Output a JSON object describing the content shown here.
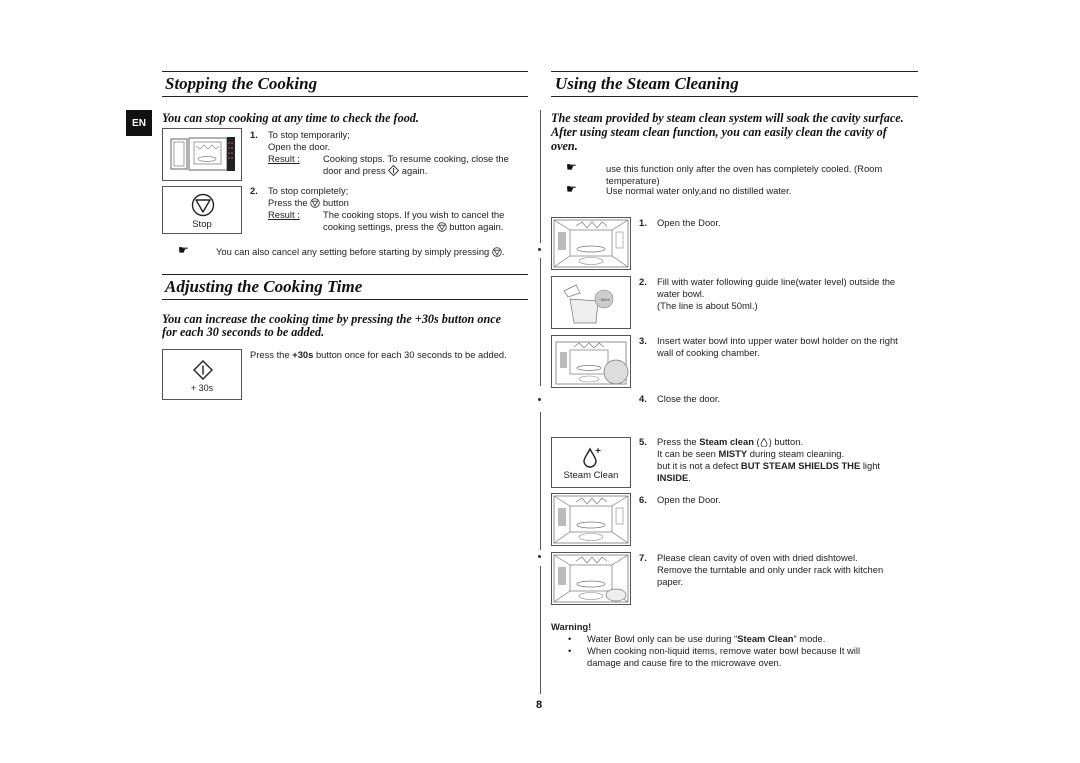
{
  "language_tab": "EN",
  "page_number": "8",
  "left": {
    "stopping": {
      "title": "Stopping the Cooking",
      "lead": "You can stop cooking at any time to check the food.",
      "steps": [
        {
          "num": "1.",
          "line1": "To stop temporarily;",
          "line2": "Open the door.",
          "result_label": "Result :",
          "result_line1": "Cooking stops. To resume cooking, close the",
          "result_line2_pre": "door and press",
          "result_line2_post": "again."
        },
        {
          "num": "2.",
          "line1": "To stop completely;",
          "line2_pre": "Press the",
          "line2_post": "button",
          "result_label": "Result :",
          "result_line1": "The cooking stops. If you wish to cancel the",
          "result_line2_pre": "cooking settings, press the",
          "result_line2_post": "button again."
        }
      ],
      "stop_button_label": "Stop",
      "note": "You can also cancel any setting before starting by simply pressing",
      "note_end": "."
    },
    "adjusting": {
      "title": "Adjusting the Cooking Time",
      "lead_line1": "You can increase the cooking time by pressing the +30s button once",
      "lead_line2": "for each 30 seconds to be added.",
      "text_pre": "Press the",
      "text_bold": "+30s",
      "text_post": "button once for each 30 seconds to be added.",
      "button_label": "+ 30s"
    }
  },
  "right": {
    "title": "Using the Steam Cleaning",
    "lead_line1": "The steam provided by steam clean system will soak the cavity surface.",
    "lead_line2": "After using steam clean function, you can easily clean the cavity of",
    "lead_line3": "oven.",
    "notes": [
      {
        "line1": "use this function only after the oven has completely cooled. (Room",
        "line2": "temperature)"
      },
      {
        "line1": "Use normal water only,and no distilled water."
      }
    ],
    "steps": [
      {
        "num": "1.",
        "line1": "Open the Door."
      },
      {
        "num": "2.",
        "line1": "Fill with water following guide line(water level) outside the",
        "line2": "water bowl.",
        "line3": "(The line is about 50ml.)"
      },
      {
        "num": "3.",
        "line1": "Insert water bowl into upper water bowl holder on the right",
        "line2": "wall of cooking chamber."
      },
      {
        "num": "4.",
        "line1": "Close the door."
      },
      {
        "num": "5.",
        "line1_pre": "Press the",
        "line1_bold": "Steam clean",
        "line1_post": ") button.",
        "line2_pre": "It can be seen",
        "line2_bold": "MISTY",
        "line2_post": "during steam cleaning.",
        "line3_pre": "but it is not a defect",
        "line3_bold": "BUT STEAM SHIELDS THE",
        "line3_post": "light",
        "line4_bold": "INSIDE",
        "line4_post": "."
      },
      {
        "num": "6.",
        "line1": "Open the Door."
      },
      {
        "num": "7.",
        "line1": "Please clean cavity of oven with dried dishtowel.",
        "line2": "Remove the turntable and only under rack with kitchen",
        "line3": "paper."
      }
    ],
    "steam_button_label": "Steam Clean",
    "bowl_label": "~50ml",
    "warning": {
      "title": "Warning!",
      "items": [
        {
          "pre": "Water Bowl only can be use during “",
          "bold": "Steam Clean",
          "post": "” mode."
        },
        {
          "line1": "When cooking non-liquid items, remove water bowl because It will",
          "line2": "damage and cause fire to the microwave oven."
        }
      ]
    }
  }
}
